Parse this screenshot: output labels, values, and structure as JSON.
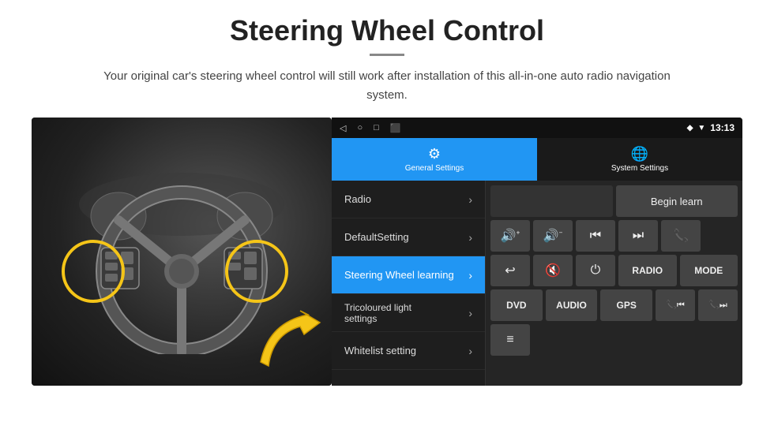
{
  "header": {
    "title": "Steering Wheel Control",
    "divider": true,
    "subtitle": "Your original car's steering wheel control will still work after installation of this all-in-one auto radio navigation system."
  },
  "status_bar": {
    "nav_icons": [
      "◁",
      "○",
      "□",
      "⬛"
    ],
    "right_icons": [
      "◆",
      "▼"
    ],
    "time": "13:13",
    "location_icon": "◆"
  },
  "tabs": [
    {
      "id": "general",
      "label": "General Settings",
      "active": true
    },
    {
      "id": "system",
      "label": "System Settings",
      "active": false
    }
  ],
  "menu_items": [
    {
      "id": "radio",
      "label": "Radio",
      "active": false
    },
    {
      "id": "default",
      "label": "DefaultSetting",
      "active": false
    },
    {
      "id": "steering",
      "label": "Steering Wheel learning",
      "active": true
    },
    {
      "id": "tricoloured",
      "label": "Tricoloured light settings",
      "active": false
    },
    {
      "id": "whitelist",
      "label": "Whitelist setting",
      "active": false
    }
  ],
  "control_panel": {
    "row1": {
      "empty_box": "",
      "begin_learn_label": "Begin learn"
    },
    "row2_icons": [
      "🔊+",
      "🔊−",
      "⏮",
      "⏭",
      "📞"
    ],
    "row3_icons": [
      "↩",
      "🔊×",
      "⏻",
      "RADIO",
      "MODE"
    ],
    "row4_labels": [
      "DVD",
      "AUDIO",
      "GPS",
      "📞⏮",
      "📞⏭"
    ],
    "row5_icons": [
      "≡"
    ]
  }
}
